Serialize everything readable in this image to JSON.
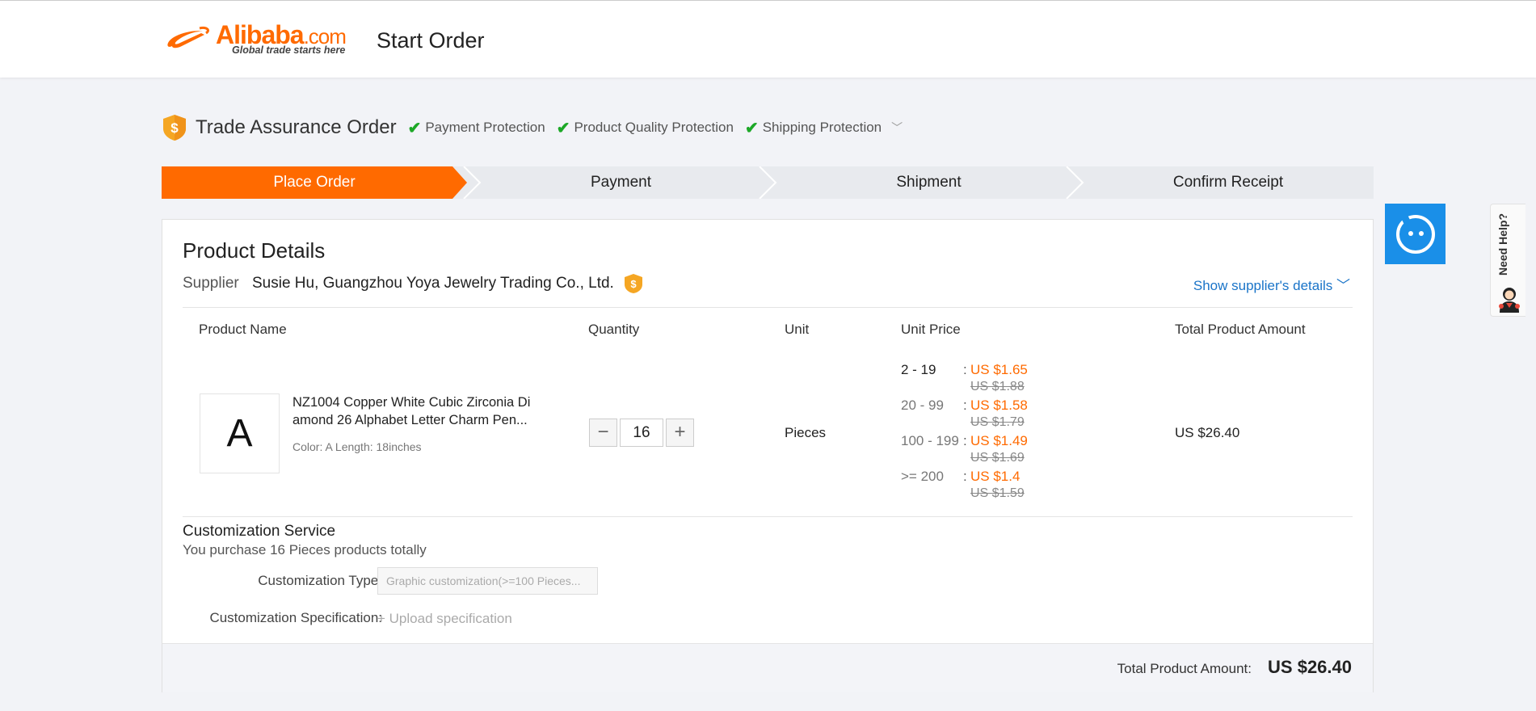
{
  "header": {
    "logo_brand": "Alibaba",
    "logo_domain": ".com",
    "logo_tagline": "Global trade starts here",
    "page_title": "Start Order"
  },
  "trade_assurance": {
    "title": "Trade Assurance Order",
    "protections": [
      "Payment Protection",
      "Product Quality Protection",
      "Shipping Protection"
    ],
    "icon": "shield-dollar-icon"
  },
  "steps": [
    "Place Order",
    "Payment",
    "Shipment",
    "Confirm Receipt"
  ],
  "active_step": "Place Order",
  "product_details": {
    "title": "Product Details",
    "supplier_label": "Supplier",
    "supplier_name": "Susie Hu, Guangzhou Yoya Jewelry Trading Co., Ltd.",
    "show_supplier_link": "Show supplier's details",
    "columns": [
      "Product Name",
      "Quantity",
      "Unit",
      "Unit Price",
      "Total Product Amount"
    ],
    "product": {
      "thumb_letter": "A",
      "name": "NZ1004 Copper White Cubic Zirconia Di amond 26 Alphabet Letter Charm Pen...",
      "attributes": "Color: A Length: 18inches",
      "quantity": "16",
      "unit": "Pieces",
      "price_tiers": [
        {
          "range": "2 - 19",
          "price": "US $1.65",
          "old_price": "US $1.88"
        },
        {
          "range": "20 - 99",
          "price": "US $1.58",
          "old_price": "US $1.79"
        },
        {
          "range": "100 - 199",
          "price": "US $1.49",
          "old_price": "US $1.69"
        },
        {
          "range": ">= 200",
          "price": "US $1.4",
          "old_price": "US $1.59"
        }
      ],
      "total": "US $26.40"
    }
  },
  "customization": {
    "title": "Customization Service",
    "subtitle": "You purchase 16 Pieces products totally",
    "type_label": "Customization Type:",
    "type_value": "Graphic customization(>=100 Pieces...",
    "spec_label": "Customization Specification:",
    "upload_text": "+ Upload specification"
  },
  "footer": {
    "total_label": "Total Product Amount:",
    "total_value": "US $26.40"
  },
  "side": {
    "need_help": "Need Help?"
  },
  "colors": {
    "brand_orange": "#ff6a00",
    "link_blue": "#1a74c8",
    "check_green": "#1da827",
    "chat_blue": "#1a8fe8"
  }
}
